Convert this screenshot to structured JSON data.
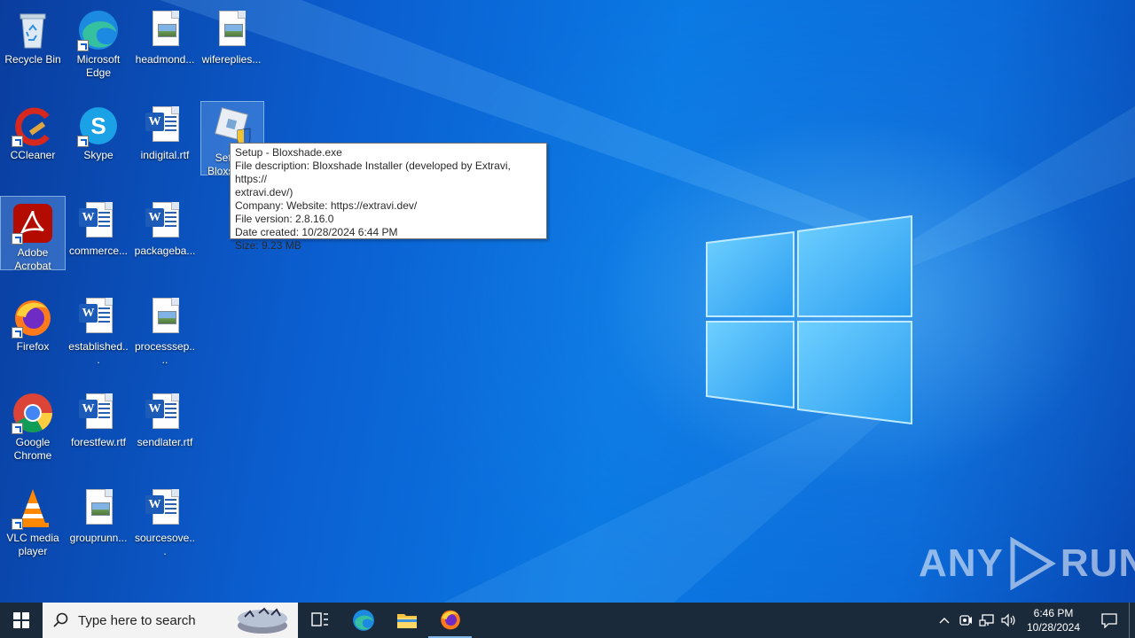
{
  "desktop": {
    "icons": [
      {
        "label": "Recycle Bin",
        "type": "recycle-bin"
      },
      {
        "label": "Microsoft Edge",
        "type": "edge"
      },
      {
        "label": "headmond...",
        "type": "image-doc"
      },
      {
        "label": "wifereplies...",
        "type": "image-doc"
      },
      {
        "label": "CCleaner",
        "type": "ccleaner"
      },
      {
        "label": "Skype",
        "type": "skype"
      },
      {
        "label": "indigital.rtf",
        "type": "word-doc"
      },
      {
        "label": "Setup - Bloxshade",
        "type": "installer"
      },
      {
        "label": "Adobe Acrobat",
        "type": "acrobat"
      },
      {
        "label": "commerce...",
        "type": "word-doc"
      },
      {
        "label": "packageba...",
        "type": "word-doc"
      },
      {
        "label": "Firefox",
        "type": "firefox"
      },
      {
        "label": "established...",
        "type": "word-doc"
      },
      {
        "label": "processsep....",
        "type": "image-doc"
      },
      {
        "label": "Google Chrome",
        "type": "chrome"
      },
      {
        "label": "forestfew.rtf",
        "type": "word-doc"
      },
      {
        "label": "sendlater.rtf",
        "type": "word-doc"
      },
      {
        "label": "VLC media player",
        "type": "vlc"
      },
      {
        "label": "grouprunn...",
        "type": "image-doc"
      },
      {
        "label": "sourcesove...",
        "type": "word-doc"
      }
    ]
  },
  "tooltip": {
    "line1": "Setup - Bloxshade.exe",
    "line2": "File description: Bloxshade Installer (developed by Extravi, https://",
    "line3": "extravi.dev/)",
    "line4": "Company: Website: https://extravi.dev/",
    "line5": "File version: 2.8.16.0",
    "line6": "Date created: 10/28/2024 6:44 PM",
    "line7": "Size: 9.23 MB"
  },
  "watermark": {
    "left": "ANY",
    "right": "RUN"
  },
  "taskbar": {
    "search_placeholder": "Type here to search",
    "clock_time": "6:46 PM",
    "clock_date": "10/28/2024"
  },
  "colors": {
    "taskbar": "#1b2a3a",
    "accent": "#0a79e3"
  }
}
